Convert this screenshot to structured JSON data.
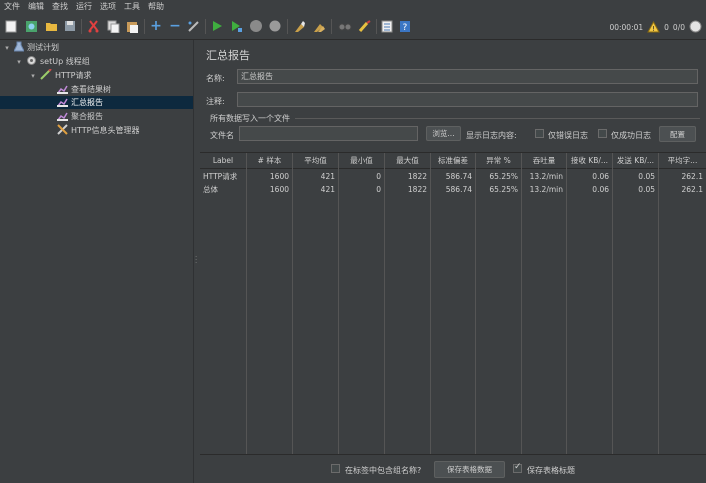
{
  "menu": [
    "文件",
    "编辑",
    "查找",
    "运行",
    "选项",
    "工具",
    "帮助"
  ],
  "status": {
    "timer": "00:00:01",
    "warnings": "0",
    "threads": "0/0"
  },
  "tree": [
    {
      "label": "测试计划",
      "icon": "test-plan-icon",
      "level": 0,
      "toggle": "⊗"
    },
    {
      "label": "setUp 线程组",
      "icon": "gear-icon",
      "level": 1,
      "toggle": "⊗"
    },
    {
      "label": "HTTP请求",
      "icon": "pipette-icon",
      "level": 2,
      "toggle": "⊗"
    },
    {
      "label": "查看结果树",
      "icon": "chart-icon",
      "level": 3,
      "toggle": ""
    },
    {
      "label": "汇总报告",
      "icon": "chart-icon",
      "level": 3,
      "toggle": "",
      "selected": true
    },
    {
      "label": "聚合报告",
      "icon": "chart-icon",
      "level": 3,
      "toggle": ""
    },
    {
      "label": "HTTP信息头管理器",
      "icon": "tools-icon",
      "level": 3,
      "toggle": ""
    }
  ],
  "panel": {
    "title": "汇总报告",
    "name_label": "名称:",
    "name_value": "汇总报告",
    "comment_label": "注释:",
    "comment_value": "",
    "group_title": "所有数据写入一个文件",
    "file_label": "文件名",
    "file_value": "",
    "browse_label": "浏览...",
    "log_label": "显示日志内容:",
    "errors_only_label": "仅错误日志",
    "success_only_label": "仅成功日志",
    "config_label": "配置"
  },
  "table": {
    "headers": [
      "Label",
      "# 样本",
      "平均值",
      "最小值",
      "最大值",
      "标准偏差",
      "异常 %",
      "吞吐量",
      "接收 KB/...",
      "发送 KB/...",
      "平均字..."
    ],
    "rows": [
      [
        "HTTP请求",
        "1600",
        "421",
        "0",
        "1822",
        "586.74",
        "65.25%",
        "13.2/min",
        "0.06",
        "0.05",
        "262.1"
      ],
      [
        "总体",
        "1600",
        "421",
        "0",
        "1822",
        "586.74",
        "65.25%",
        "13.2/min",
        "0.06",
        "0.05",
        "262.1"
      ]
    ]
  },
  "bottom": {
    "include_group_label": "在标签中包含组名称?",
    "save_table_label": "保存表格数据",
    "save_header_label": "保存表格标题"
  },
  "colors": {
    "background": "#3c3f41",
    "selection": "#0d293e",
    "play": "#3fae3f",
    "warning": "#f2c744"
  }
}
